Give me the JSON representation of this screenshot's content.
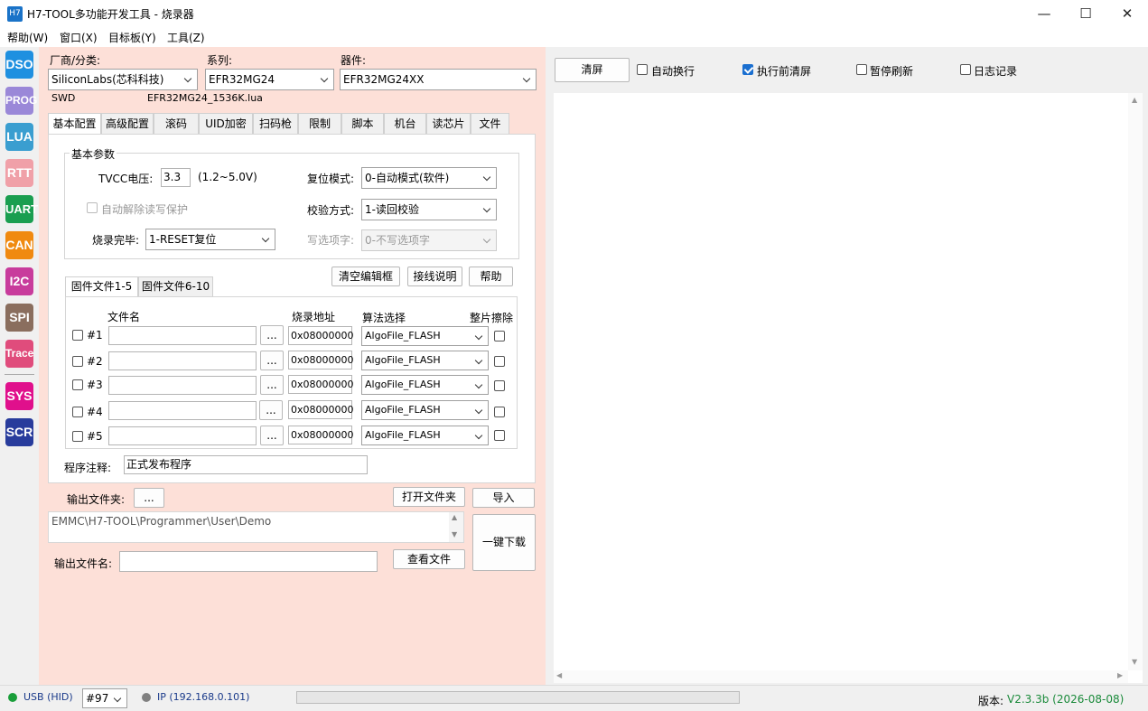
{
  "window": {
    "icon_text": "H7",
    "title": "H7-TOOL多功能开发工具 - 烧录器"
  },
  "menu": [
    "帮助(W)",
    "窗口(X)",
    "目标板(Y)",
    "工具(Z)"
  ],
  "sidebar": [
    "DSO",
    "PROG",
    "LUA",
    "RTT",
    "UART",
    "CAN",
    "I2C",
    "SPI",
    "Trace",
    "SYS",
    "SCR"
  ],
  "sidebar_colors": [
    "#1e90e0",
    "#9a88d8",
    "#3a9ed0",
    "#f0a0a8",
    "#1a9e50",
    "#f08a10",
    "#c83c9c",
    "#8a6e5e",
    "#e04c7c",
    "#e0108c",
    "#283c9c"
  ],
  "device": {
    "vendor_label": "厂商/分类:",
    "vendor": "SiliconLabs(芯科科技)",
    "series_label": "系列:",
    "series": "EFR32MG24",
    "device_label": "器件:",
    "device": "EFR32MG24XX",
    "interface": "SWD",
    "script": "EFR32MG24_1536K.lua"
  },
  "tabs": [
    "基本配置",
    "高级配置",
    "滚码",
    "UID加密",
    "扫码枪",
    "限制",
    "脚本",
    "机台",
    "读芯片",
    "文件"
  ],
  "basic": {
    "group_title": "基本参数",
    "tvcc_label": "TVCC电压:",
    "tvcc_value": "3.3",
    "tvcc_range": "(1.2~5.0V)",
    "auto_unlock": "自动解除读写保护",
    "done_label": "烧录完毕:",
    "done_value": "1-RESET复位",
    "reset_label": "复位模式:",
    "reset_value": "0-自动模式(软件)",
    "verify_label": "校验方式:",
    "verify_value": "1-读回校验",
    "option_label": "写选项字:",
    "option_value": "0-不写选项字"
  },
  "buttons": {
    "clear_editor": "清空编辑框",
    "wiring": "接线说明",
    "help": "帮助",
    "open_folder": "打开文件夹",
    "import": "导入",
    "download": "一键下载",
    "view_file": "查看文件",
    "browse": "..."
  },
  "file_tabs": [
    "固件文件1-5",
    "固件文件6-10"
  ],
  "file_table": {
    "headers": {
      "name": "文件名",
      "addr": "烧录地址",
      "algo": "算法选择",
      "erase": "整片擦除"
    },
    "rows": [
      {
        "id": "#1",
        "addr": "0x08000000",
        "algo": "AlgoFile_FLASH"
      },
      {
        "id": "#2",
        "addr": "0x08000000",
        "algo": "AlgoFile_FLASH"
      },
      {
        "id": "#3",
        "addr": "0x08000000",
        "algo": "AlgoFile_FLASH"
      },
      {
        "id": "#4",
        "addr": "0x08000000",
        "algo": "AlgoFile_FLASH"
      },
      {
        "id": "#5",
        "addr": "0x08000000",
        "algo": "AlgoFile_FLASH"
      }
    ]
  },
  "comment": {
    "label": "程序注释:",
    "value": "正式发布程序"
  },
  "output": {
    "folder_label": "输出文件夹:",
    "folder_path": "EMMC\\H7-TOOL\\Programmer\\User\\Demo",
    "file_label": "输出文件名:",
    "file_value": ""
  },
  "log": {
    "clear": "清屏",
    "auto_wrap": "自动换行",
    "clear_before": "执行前清屏",
    "pause": "暂停刷新",
    "log_record": "日志记录",
    "clear_before_checked": true
  },
  "status": {
    "usb": "USB (HID)",
    "port": "#97",
    "ip": "IP (192.168.0.101)",
    "version_label": "版本:",
    "version": "V2.3.3b (2026-08-08)",
    "usb_color": "#1a9e3a",
    "ip_color": "#808080",
    "version_color": "#1a8a3a"
  }
}
